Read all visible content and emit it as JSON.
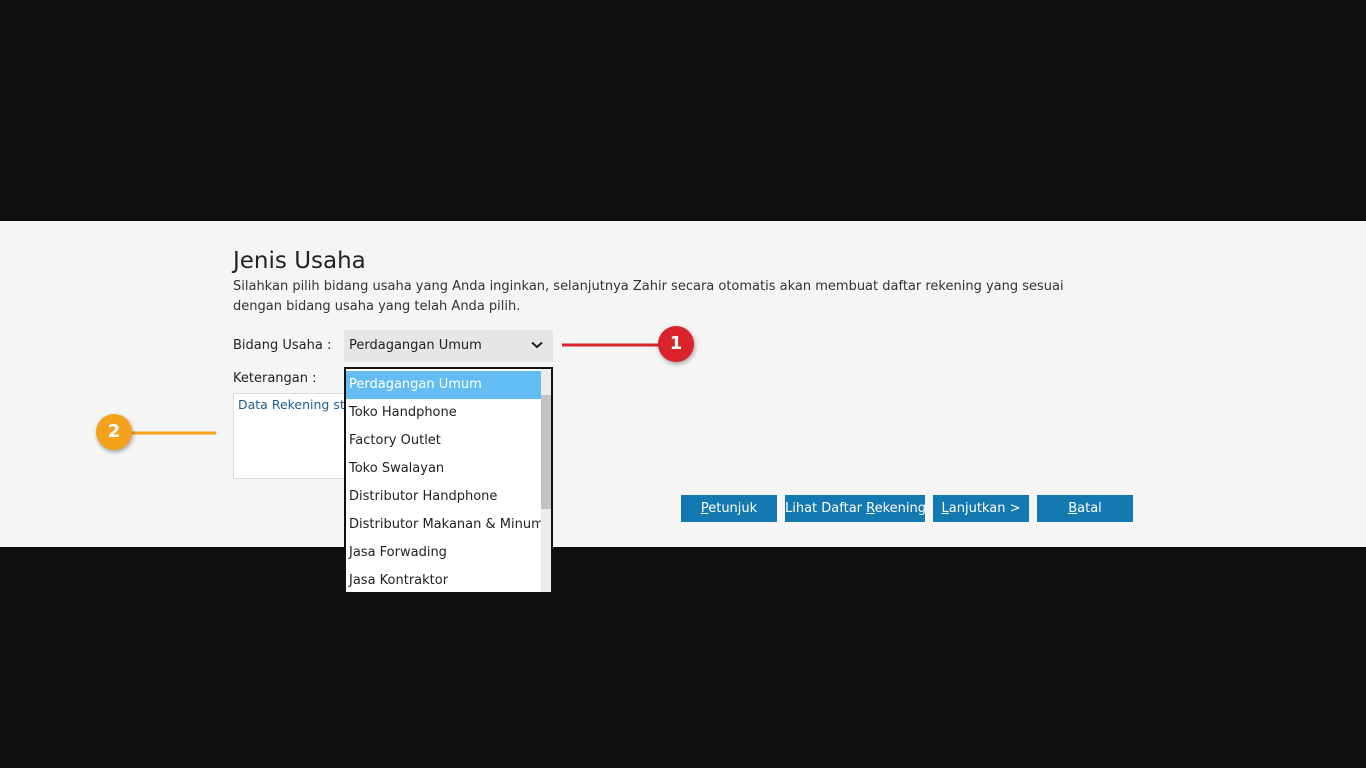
{
  "header": {
    "title": "Jenis Usaha",
    "description": "Silahkan pilih bidang usaha yang Anda inginkan, selanjutnya Zahir secara otomatis akan membuat daftar rekening yang sesuai dengan bidang usaha yang telah Anda pilih."
  },
  "form": {
    "bidang_label": "Bidang Usaha :",
    "bidang_value": "Perdagangan Umum",
    "keterangan_label": "Keterangan :",
    "keterangan_value": "Data Rekening standar"
  },
  "dropdown": {
    "options": [
      "Perdagangan Umum",
      "Toko Handphone",
      "Factory Outlet",
      "Toko Swalayan",
      "Distributor Handphone",
      "Distributor Makanan & Minum",
      "Jasa Forwading",
      "Jasa Kontraktor"
    ],
    "selected_index": 0
  },
  "buttons": {
    "petunjuk": {
      "hotkey": "P",
      "rest": "etunjuk"
    },
    "lihat": {
      "pre": "Lihat Daftar ",
      "hotkey": "R",
      "rest": "ekening"
    },
    "lanjutkan": {
      "hotkey": "L",
      "rest": "anjutkan >"
    },
    "batal": {
      "hotkey": "B",
      "rest": "atal"
    }
  },
  "callouts": {
    "one": "1",
    "two": "2"
  },
  "colors": {
    "accent_button": "#1479b0",
    "selected_option": "#63bdf2",
    "callout_one": "#d9222a",
    "callout_two": "#f4a21e"
  }
}
